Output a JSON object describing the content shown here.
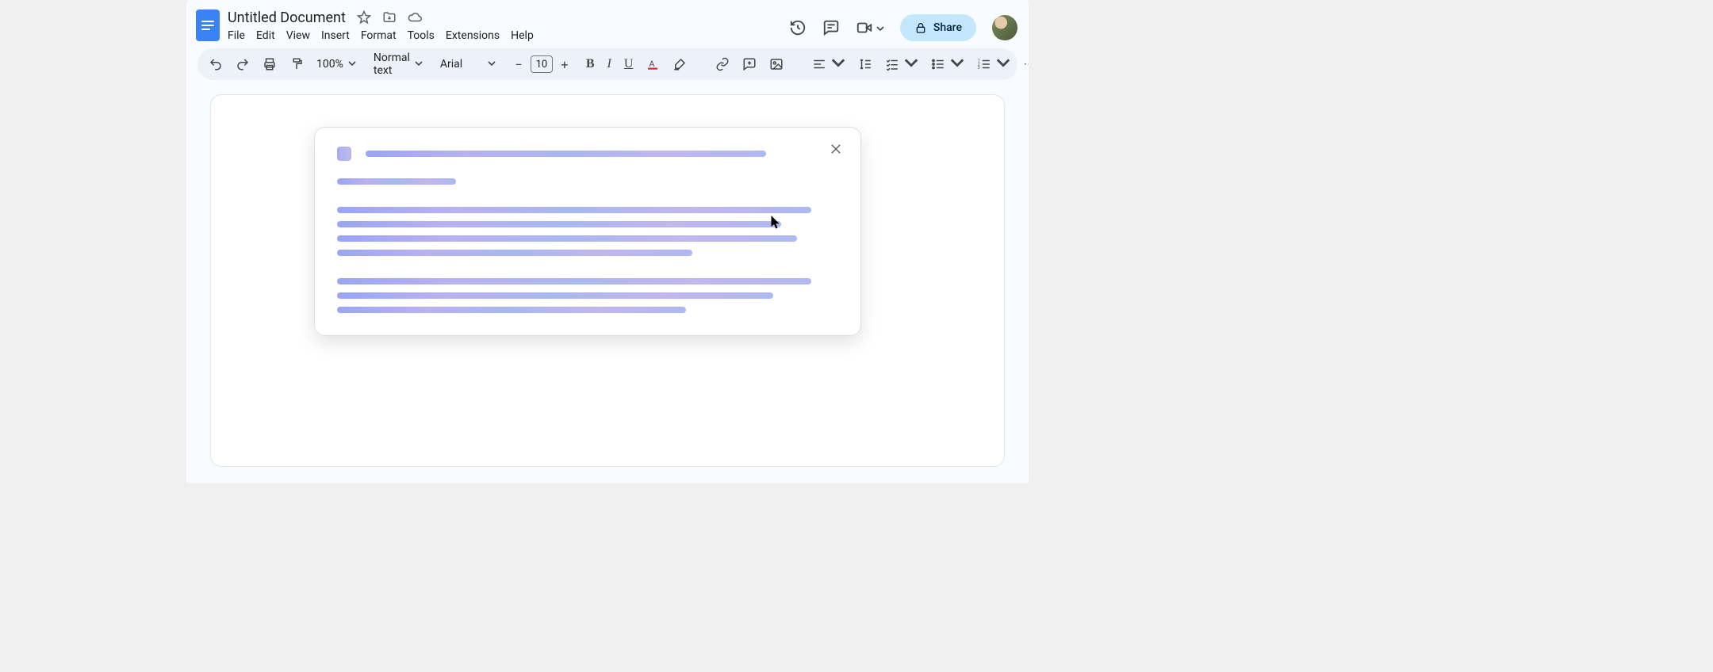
{
  "doc": {
    "title": "Untitled Document"
  },
  "menus": {
    "file": "File",
    "edit": "Edit",
    "view": "View",
    "insert": "Insert",
    "format": "Format",
    "tools": "Tools",
    "extensions": "Extensions",
    "help": "Help"
  },
  "toolbar": {
    "zoom": "100%",
    "style": "Normal text",
    "font": "Arial",
    "font_size": "10"
  },
  "share": {
    "label": "Share"
  }
}
